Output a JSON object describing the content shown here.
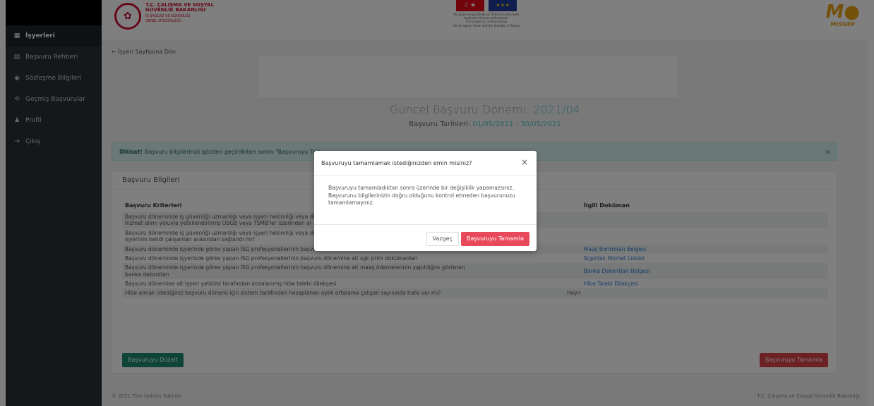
{
  "sidebar": {
    "items": [
      {
        "label": "İşyerleri",
        "icon": "building-icon",
        "glyph": "▦"
      },
      {
        "label": "Başvuru Rehberi",
        "icon": "book-icon",
        "glyph": "▤"
      },
      {
        "label": "Sözleşme Bilgileri",
        "icon": "eye-icon",
        "glyph": "◉"
      },
      {
        "label": "Geçmiş Başvurular",
        "icon": "history-icon",
        "glyph": "⟲"
      },
      {
        "label": "Profil",
        "icon": "user-icon",
        "glyph": "♟"
      },
      {
        "label": "Çıkış",
        "icon": "logout-icon",
        "glyph": "⇥"
      }
    ]
  },
  "header": {
    "ministry_line1": "T.C. ÇALIŞMA VE SOSYAL",
    "ministry_line2": "GÜVENLİK BAKANLIĞI",
    "ministry_sub1": "İŞ SAĞLIĞI VE GÜVENLİĞİ",
    "ministry_sub2": "GENEL MÜDÜRLÜĞÜ",
    "eu_text1": "Bu proje Avrupa Birliği ve Türkiye Cumhuriyeti",
    "eu_text2": "tarafından finanse edilmektedir.",
    "eu_text3": "This project is co-financed by",
    "eu_text4": "the European Union and the Republic of Turkey",
    "misgep_label": "MISGEP"
  },
  "content": {
    "back_link": "← İşyeri Sayfasına Dön",
    "period_label": "Güncel Başvuru Dönemi:",
    "period_value": "2021/04",
    "dates_label": "Başvuru Tarihleri:",
    "dates_value": "01/05/2021 - 30/05/2021",
    "alert_bold": "Dikkat!",
    "alert_text": "Başvuru bilgilerinizi gözden geçirdikten sonra \"Başvuruyu Tam",
    "card_title": "Başvuru Bilgileri",
    "table": {
      "headers": [
        "Başvuru Kriterleri",
        "",
        "İlgili Doküman"
      ],
      "rows": [
        {
          "criterion": "Başvuru döneminde iş güvenliği uzmanlığı veya işyeri hekimliği veya di",
          "criterion2": "hizmet alımı yoluyla yetkilendirilmiş OSGB veya TSMB'ler üzerinden al",
          "answer": "",
          "doc": ""
        },
        {
          "criterion": "Başvuru döneminde iş güvenliği uzmanlığı veya işyeri hekimliği veya di",
          "criterion2": "işyerinin kendi çalışanları arasından sağlandı mı?",
          "answer": "",
          "doc": ""
        },
        {
          "criterion": "Başvuru döneminde işyerinde görev yapan İSG profesyonellerinin başvuru dönemine ait maaş bordroları",
          "criterion2": "",
          "answer": "",
          "doc": "Maaş Bordroları Belgesi"
        },
        {
          "criterion": "Başvuru döneminde işyerinde görev yapan İSG profesyonellerinin başvuru dönemine ait sgk prim dokümanları",
          "criterion2": "",
          "answer": "",
          "doc": "Sigortalı Hizmet Listesi"
        },
        {
          "criterion": "Başvuru döneminde işyerinde görev yapan İSG profesyonellerinin başvuru dönemine ait maaş ödemelerinin yapıldığını gösteren",
          "criterion2": "banka dekontları",
          "answer": "",
          "doc": "Banka Dekontları Belgesi"
        },
        {
          "criterion": "Başvuru dönemine ait işyeri yetkilisi tarafından imzalanmış hibe talebi dilekçesi",
          "criterion2": "",
          "answer": "",
          "doc": "Hibe Talebi Dilekçesi"
        },
        {
          "criterion": "Hibe almak istediğiniz başvuru dönemi için sistem tarafından hesaplanan aylık ortalama çalışan sayısında hata var mı?",
          "criterion2": "",
          "answer": "Hayır",
          "doc": ""
        }
      ]
    },
    "edit_button": "Başvuruyu Düzelt",
    "complete_button": "Başvuruyu Tamamla"
  },
  "footer": {
    "left": "© 2021 Tüm Hakları Saklıdır",
    "right": "T.C. Çalışma ve Sosyal Güvenlik Bakanlığı"
  },
  "modal": {
    "title": "Başvuruyu tamamlamak istediğinizden emin misiniz?",
    "body": "Başvuruyu tamamladıktan sonra üzerinde bir değişiklik yapamazsınız. Başvurunu bilgilerinizin doğru olduğunu kontrol etmeden başvurunuzu tamamlamayınız.",
    "cancel_label": "Vazgeç",
    "confirm_label": "Başvuruyu Tamamla",
    "close_glyph": "×"
  },
  "colors": {
    "sidebar_bg": "#2b3137",
    "accent_teal": "#5bc0be",
    "edit_green": "#1f8a70",
    "danger_red": "#e8495a",
    "link_blue": "#2a7fd4"
  }
}
